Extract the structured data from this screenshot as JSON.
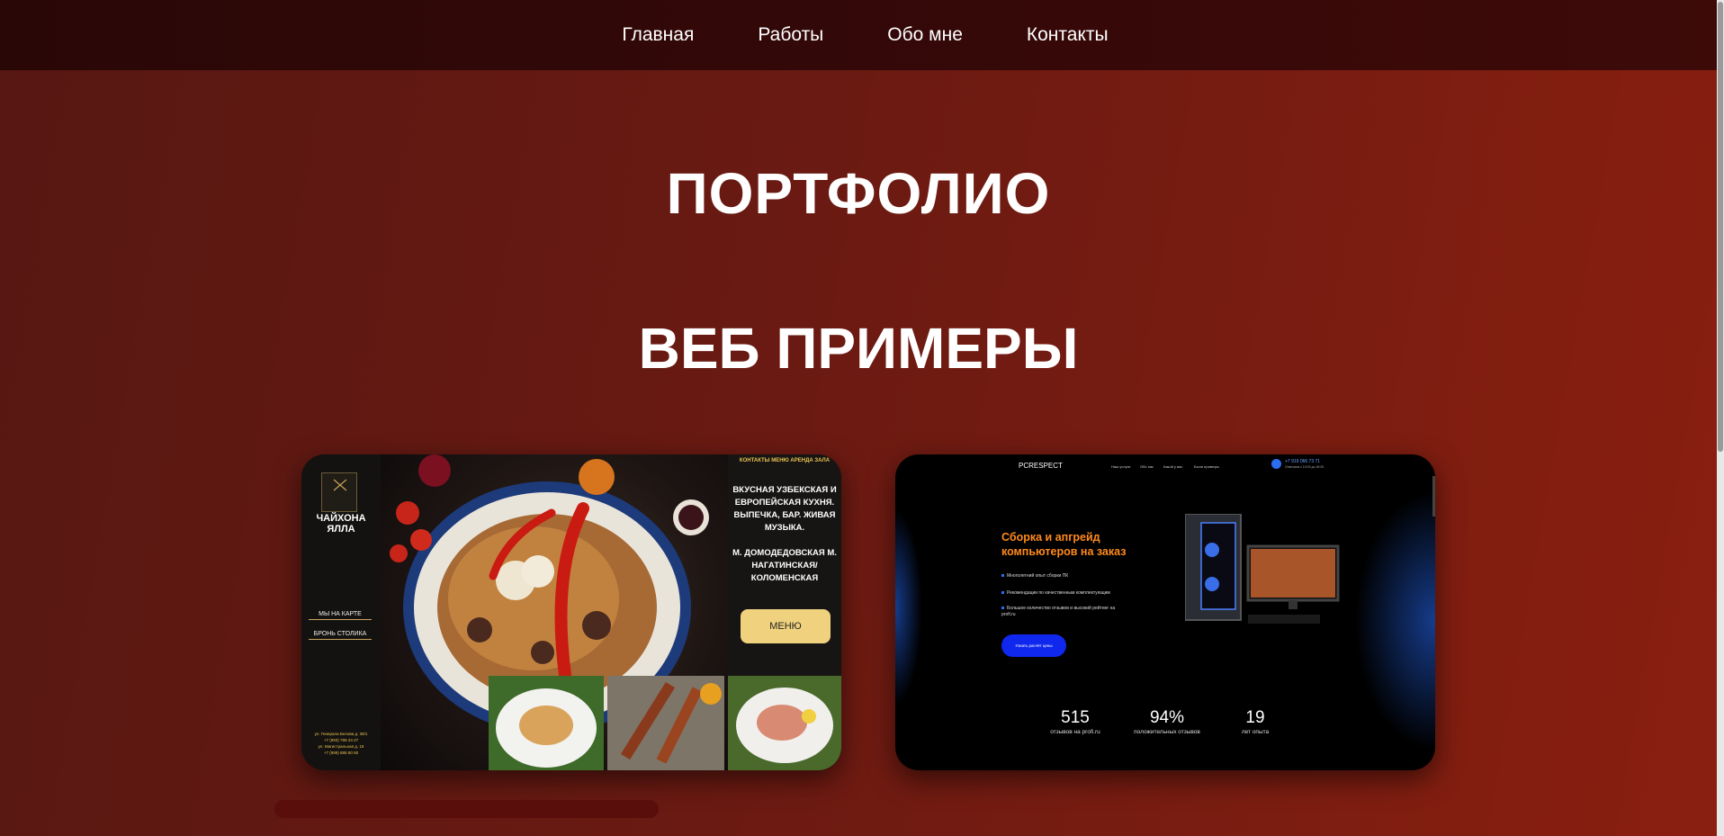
{
  "nav": {
    "items": [
      "Главная",
      "Работы",
      "Обо мне",
      "Контакты"
    ]
  },
  "headings": {
    "portfolio": "ПОРТФОЛИО",
    "web_examples": "ВЕБ ПРИМЕРЫ"
  },
  "cards": {
    "chaihona": {
      "logo_text": "ЯЛЛА чайхона",
      "title": "ЧАЙХОНА ЯЛЛА",
      "link_map": "МЫ НА КАРТЕ",
      "link_booking": "БРОНЬ СТОЛИКА",
      "address_lines": [
        "ул. Генерала Белова д. 38/1",
        "+7 (993) 798 34 27",
        "ул. Магистральная д. 18",
        "+7 (999) 888 80 50"
      ],
      "top_menu": "КОНТАКТЫ  МЕНЮ  АРЕНДА ЗАЛА",
      "tagline": "ВКУСНАЯ УЗБЕКСКАЯ И ЕВРОПЕЙСКАЯ КУХНЯ. ВЫПЕЧКА, БАР. ЖИВАЯ МУЗЫКА.",
      "metro": "М. ДОМОДЕДОВСКАЯ М. НАГАТИНСКАЯ/ КОЛОМЕНСКАЯ",
      "menu_button": "МЕНЮ"
    },
    "pcrespect": {
      "logo": "PCRESPECT",
      "nav": [
        "Наш услуги",
        "Обо нас",
        "Какой у вас",
        "Были примеры"
      ],
      "phone": "+7 919 066 73 71",
      "phone_note": "Отвечаем с 10:00 до 18:00",
      "title_line1": "Сборка и апгрейд",
      "title_line2": "компьютеров на заказ",
      "bullets": [
        "Многолетний опыт сборки ПК",
        "Рекомендации по качественным комплектующим",
        "Большое количество отзывов и высокий рейтинг на profi.ru"
      ],
      "button": "Узнать расчёт цены",
      "stats": [
        {
          "value": "515",
          "label": "отзывов на profi.ru"
        },
        {
          "value": "94%",
          "label": "положительных отзывов"
        },
        {
          "value": "19",
          "label": "лет опыта"
        }
      ]
    }
  },
  "colors": {
    "nav_bg": "#3d0a08",
    "accent_orange": "#ff8a1c",
    "accent_blue": "#1028ee",
    "menu_gold": "#f0d27e"
  }
}
